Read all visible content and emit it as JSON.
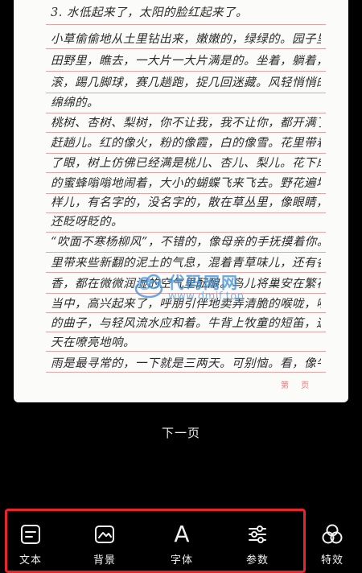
{
  "document": {
    "lines": [
      "3. 水低起来了，太阳的脸红起来了。",
      "小草偷偷地从土里钻出来，嫩嫩的，绿绿的。园子里，",
      "田野里，瞧去，一大片一大片满是的。坐着，躺着，打两个",
      "滚，踢几脚球，赛几趟跑，捉几回迷藏。风轻悄悄的，草软",
      "绵绵的。",
      "桃树、杏树、梨树，你不让我，我不让你，都开满了花",
      "赶趟儿。红的像火，粉的像霞，白的像雪。花里带着甜味儿；闭",
      "了眼，树上仿佛已经满是桃儿、杏儿、梨儿。花下成千成百",
      "的蜜蜂嗡嗡地闹着，大小的蝴蝶飞来飞去。野花遍地是：杂",
      "样儿，有名字的，没名字的，散在草丛里，像眼睛，像星星，",
      "还眨呀眨的。",
      "“吹面不寒杨柳风”，不错的，像母亲的手抚摸着你。风",
      "里带来些新翻的泥土的气息，混着青草味儿，还有各种花的",
      "香，都在微微润湿的空气里酝酿。鸟儿将巢安在繁花嫩叶",
      "当中，高兴起来了，呼朋引伴地卖弄清脆的喉咙，唱出宛转",
      "的曲子，与轻风流水应和着。牛背上牧童的短笛，这时候也成",
      "天在嘹亮地响。",
      "雨是最寻常的，一下就是三两天。可别恼。看，像牛毛，"
    ],
    "page_marker": "第 页"
  },
  "watermark": {
    "title": "代码网网",
    "url": "www.dmjf.top"
  },
  "next_page_label": "下一页",
  "toolbar": {
    "items": [
      {
        "label": "文本",
        "icon": "text-box-icon"
      },
      {
        "label": "背景",
        "icon": "image-landscape-icon"
      },
      {
        "label": "字体",
        "icon": "font-letter-a-icon"
      },
      {
        "label": "参数",
        "icon": "sliders-icon"
      },
      {
        "label": "特效",
        "icon": "three-circles-icon"
      }
    ],
    "highlight_color": "#e8252b"
  }
}
